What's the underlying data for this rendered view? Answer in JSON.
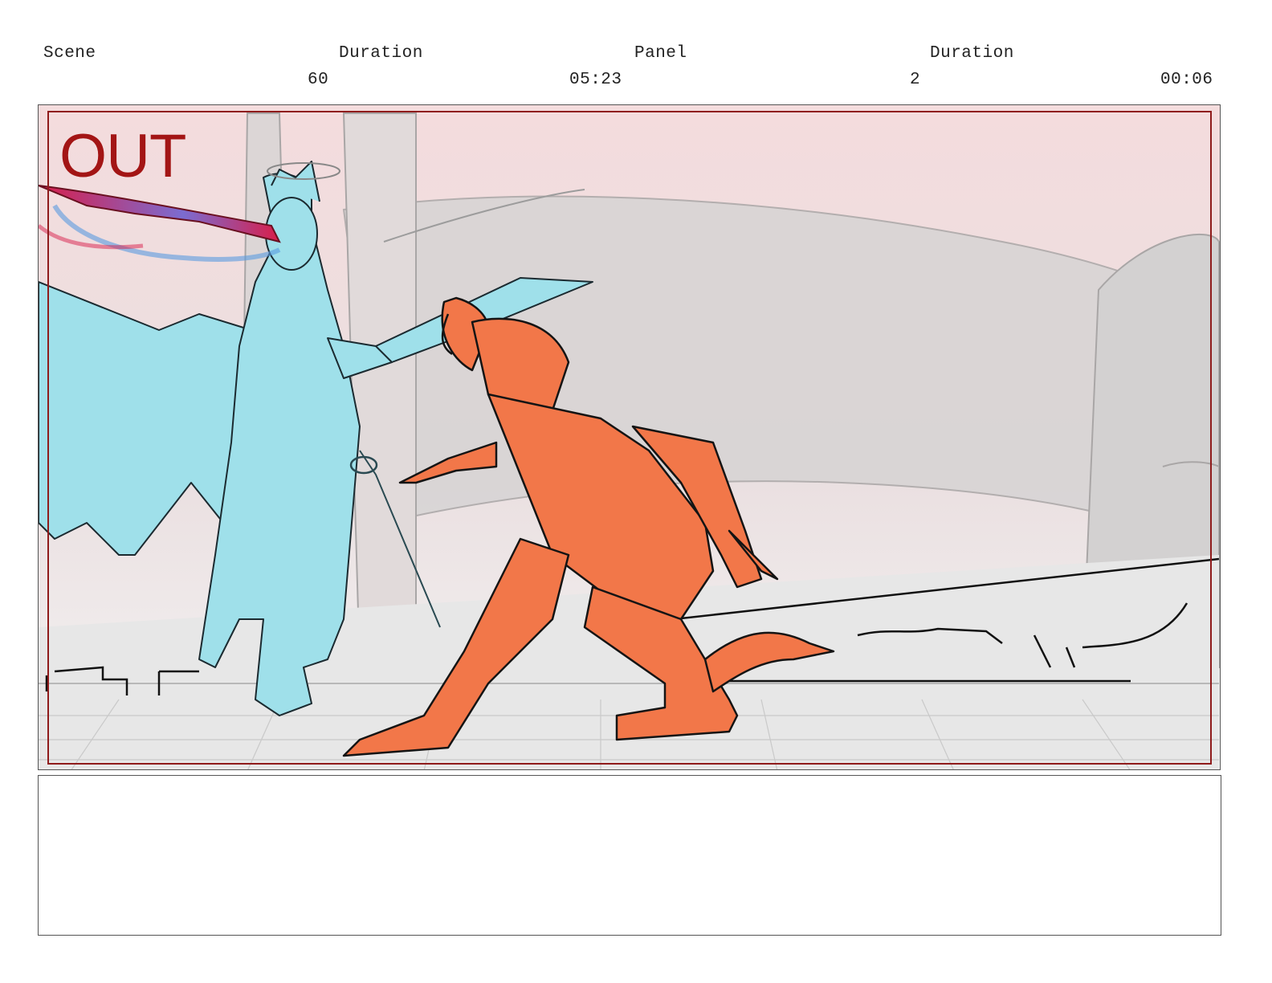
{
  "header": {
    "scene_label": "Scene",
    "scene_duration_label": "Duration",
    "panel_label": "Panel",
    "panel_duration_label": "Duration",
    "scene_value": "60",
    "scene_duration_value": "05:23",
    "panel_value": "2",
    "panel_duration_value": "00:06"
  },
  "frame": {
    "overlay_text": "OUT",
    "overlay_color": "#a31515",
    "characters": [
      {
        "name": "cyan-winged-swordsman",
        "color": "#9fe0ea"
      },
      {
        "name": "orange-horned-figure",
        "color": "#f27749"
      }
    ],
    "background_tint": "#f3dede"
  },
  "notes": {
    "text": ""
  }
}
